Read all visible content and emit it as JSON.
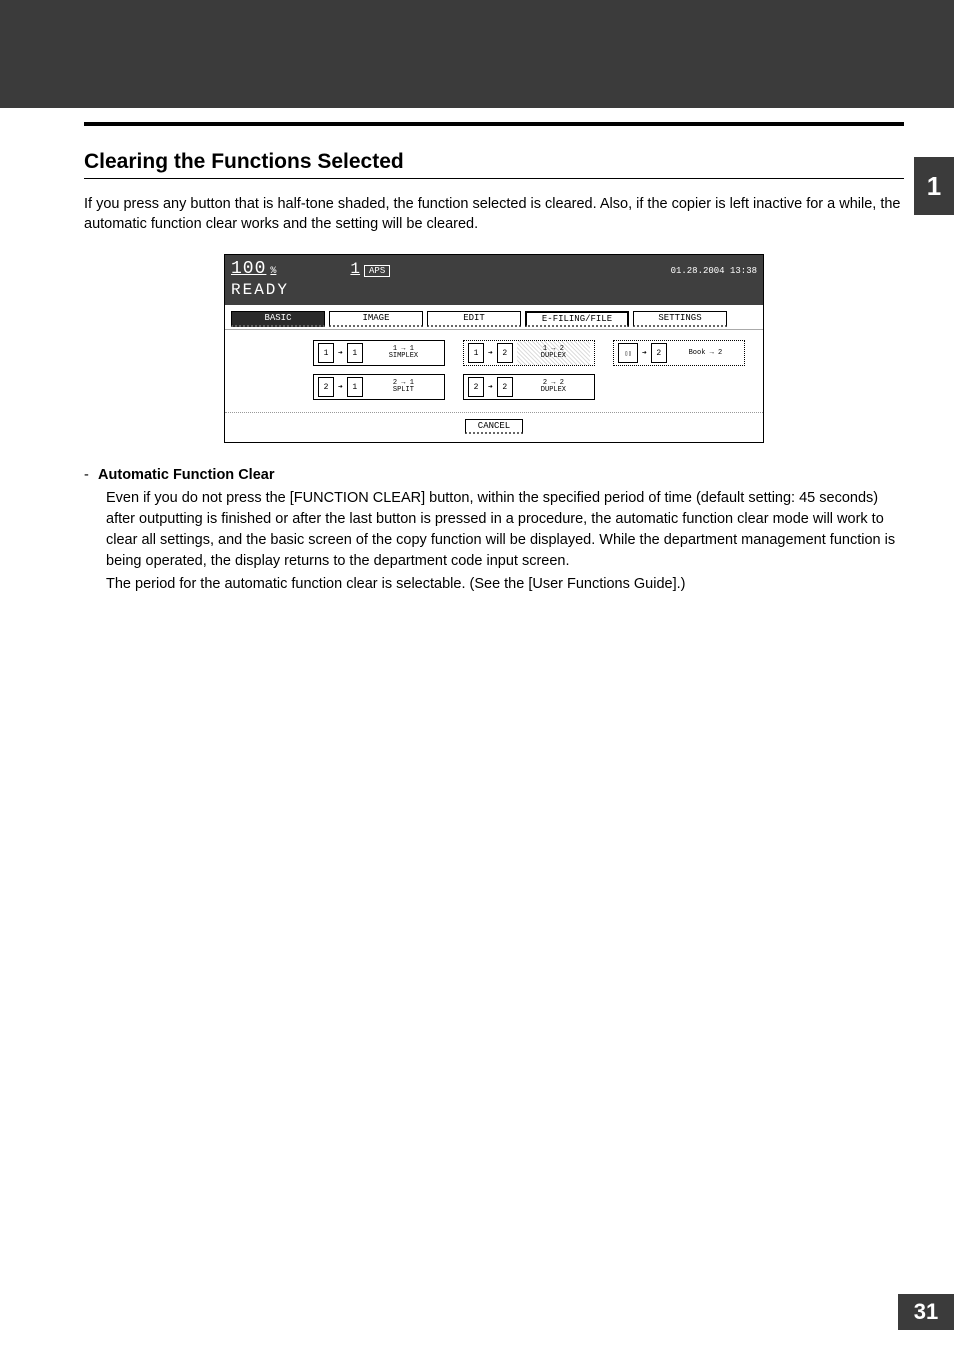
{
  "chapter_tab": "1",
  "page_number": "31",
  "section_title": "Clearing the Functions Selected",
  "intro_text": "If you press any button that is half-tone shaded, the function selected is cleared. Also, if the copier is left inactive for a while, the automatic function clear works and the setting will be cleared.",
  "panel": {
    "percent": "100",
    "percent_sym": "%",
    "count": "1",
    "aps": "APS",
    "datetime": "01.28.2004 13:38",
    "ready": "READY",
    "tabs": {
      "basic": "BASIC",
      "image": "IMAGE",
      "edit": "EDIT",
      "efiling": "E-FILING/FILE",
      "settings": "SETTINGS"
    },
    "options": {
      "simplex": {
        "top": "1 → 1",
        "bottom": "SIMPLEX"
      },
      "one_two_duplex": {
        "top": "1 → 2",
        "bottom": "DUPLEX"
      },
      "book2": {
        "top": "",
        "bottom": "Book → 2"
      },
      "split": {
        "top": "2 → 1",
        "bottom": "SPLIT"
      },
      "two_two_duplex": {
        "top": "2 → 2",
        "bottom": "DUPLEX"
      }
    },
    "cancel": "CANCEL"
  },
  "bullet": {
    "heading": "Automatic Function Clear",
    "body1": "Even if you do not press the [FUNCTION CLEAR] button, within the specified period of time (default setting: 45 seconds) after outputting is finished or after the last button is pressed in a procedure, the automatic function clear mode will work to clear all settings, and the basic screen of the copy function will be displayed. While the department management function is being operated, the display returns to the department code input screen.",
    "body2": "The period for the automatic function clear is selectable. (See the [User Functions Guide].)"
  }
}
